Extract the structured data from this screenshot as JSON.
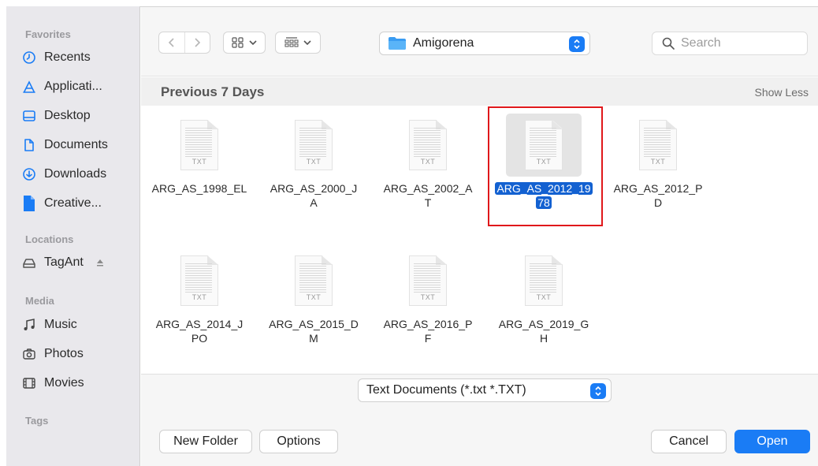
{
  "window_title_fragment": "...",
  "sidebar": {
    "sections": [
      {
        "title": "Favorites",
        "items": [
          {
            "label": "Recents",
            "icon": "clock-icon"
          },
          {
            "label": "Applicati...",
            "icon": "applications-icon"
          },
          {
            "label": "Desktop",
            "icon": "desktop-icon"
          },
          {
            "label": "Documents",
            "icon": "document-icon"
          },
          {
            "label": "Downloads",
            "icon": "download-icon"
          },
          {
            "label": "Creative...",
            "icon": "file-icon"
          }
        ]
      },
      {
        "title": "Locations",
        "items": [
          {
            "label": "TagAnt",
            "icon": "drive-icon"
          }
        ]
      },
      {
        "title": "Media",
        "items": [
          {
            "label": "Music",
            "icon": "music-icon"
          },
          {
            "label": "Photos",
            "icon": "camera-icon"
          },
          {
            "label": "Movies",
            "icon": "film-icon"
          }
        ]
      },
      {
        "title": "Tags",
        "items": []
      }
    ]
  },
  "toolbar": {
    "location": "Amigorena",
    "search_placeholder": "Search"
  },
  "content": {
    "section_title": "Previous 7 Days",
    "show_less": "Show Less",
    "file_ext_badge": "TXT",
    "files": [
      {
        "line1": "ARG_AS_1998_EL",
        "line2": "",
        "selected": false
      },
      {
        "line1": "ARG_AS_2000_J",
        "line2": "A",
        "selected": false
      },
      {
        "line1": "ARG_AS_2002_A",
        "line2": "T",
        "selected": false
      },
      {
        "line1": "ARG_AS_2012_19",
        "line2": "78",
        "selected": true
      },
      {
        "line1": "ARG_AS_2012_P",
        "line2": "D",
        "selected": false
      },
      {
        "line1": "ARG_AS_2014_J",
        "line2": "PO",
        "selected": false
      },
      {
        "line1": "ARG_AS_2015_D",
        "line2": "M",
        "selected": false
      },
      {
        "line1": "ARG_AS_2016_P",
        "line2": "F",
        "selected": false
      },
      {
        "line1": "ARG_AS_2019_G",
        "line2": "H",
        "selected": false
      }
    ]
  },
  "bottom": {
    "filter": "Text Documents (*.txt *.TXT)",
    "new_folder": "New Folder",
    "options": "Options",
    "cancel": "Cancel",
    "open": "Open"
  },
  "colors": {
    "accent": "#1a7cf5",
    "selection": "#1361d1",
    "highlight_box": "#e0181b",
    "sidebar_bg": "#e9e8ec"
  }
}
